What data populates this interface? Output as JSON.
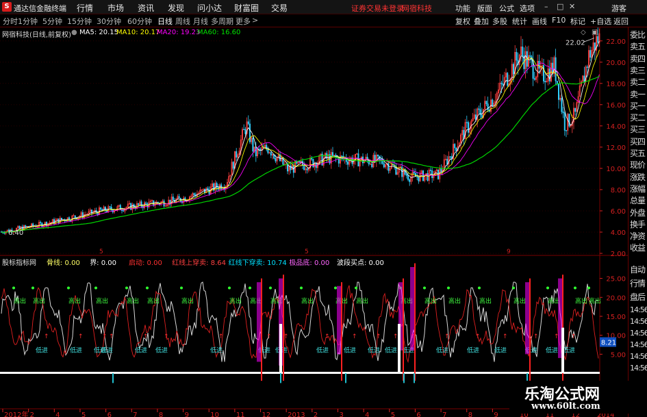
{
  "titlebar": {
    "logo_text": "S",
    "title": "通达信金融终端",
    "menus": [
      "行情",
      "市场",
      "资讯",
      "发现",
      "问小达",
      "财富圈",
      "交易"
    ],
    "notice": "证券交易未登录",
    "stock_name": "网宿科技",
    "right_menus": [
      "功能",
      "版面",
      "公式",
      "选项"
    ],
    "guest": "游客"
  },
  "periods": {
    "tabs": [
      "分时",
      "1分钟",
      "5分钟",
      "15分钟",
      "30分钟",
      "60分钟",
      "日线",
      "周线",
      "月线",
      "多周期",
      "更多"
    ],
    "active": "日线",
    "buttons": [
      "复权",
      "叠加",
      "多股",
      "统计",
      "画线",
      "F10",
      "标记",
      "+自选",
      "返回"
    ]
  },
  "main_chart": {
    "header": "网宿科技(日线,前复权)",
    "ma": [
      {
        "label": "MA5: 20.15",
        "color": "#ffffff"
      },
      {
        "label": "MA10: 20.17",
        "color": "#ffff00"
      },
      {
        "label": "MA20: 19.23",
        "color": "#ff00ff"
      },
      {
        "label": "MA60: 16.60",
        "color": "#00e000"
      }
    ],
    "yticks": [
      "22.00",
      "20.00",
      "18.00",
      "16.00",
      "14.00",
      "12.00",
      "10.00",
      "8.00",
      "6.00",
      "4.00",
      "2.00"
    ],
    "high_label": "22.02",
    "low_label": "6.40",
    "period_markers": [
      "5",
      "5",
      "9"
    ]
  },
  "indicator": {
    "header": "股标指标网",
    "items": [
      {
        "label": "骨线: 0.00",
        "color": "#ffff66"
      },
      {
        "label": "界: 0.00",
        "color": "#ffffff"
      },
      {
        "label": "启动: 0.00",
        "color": "#ff3030"
      },
      {
        "label": "红线上穿卖: 8.64",
        "color": "#ff4040"
      },
      {
        "label": "红线下穿卖: 10.74",
        "color": "#00e0ff"
      },
      {
        "label": "极品底: 0.00",
        "color": "#ff66ff"
      },
      {
        "label": "波段买点: 0.00",
        "color": "#ffffff"
      }
    ],
    "yticks": [
      "25.00",
      "20.00",
      "15.00",
      "10.00",
      "5.00"
    ],
    "current_value": "8.21",
    "sell_label": "高出",
    "buy_label": "低进"
  },
  "time_axis": {
    "labels": [
      "2012年",
      "2",
      "4",
      "5",
      "6",
      "7",
      "8",
      "9",
      "10",
      "11",
      "12",
      "2013",
      "2",
      "3",
      "4",
      "5",
      "6",
      "7",
      "8",
      "9",
      "10",
      "11",
      "12",
      "2014"
    ]
  },
  "right_panel": {
    "items": [
      "委比",
      "卖五",
      "卖四",
      "卖三",
      "卖二",
      "卖一",
      "买一",
      "买二",
      "买三",
      "买四",
      "买五",
      "现价",
      "涨跌",
      "涨幅",
      "总量",
      "外盘",
      "换手",
      "净资",
      "收益",
      "自动",
      "行情",
      "盘后",
      "14:56",
      "14:56",
      "14:56",
      "14:56",
      "14:56",
      "14:56"
    ]
  },
  "watermark": {
    "title": "乐淘公式网",
    "url": "www.60lt.com"
  },
  "colors": {
    "up": "#ff3030",
    "down": "#00e0ff",
    "grid": "#7a0000",
    "tick": "#d62020"
  }
}
